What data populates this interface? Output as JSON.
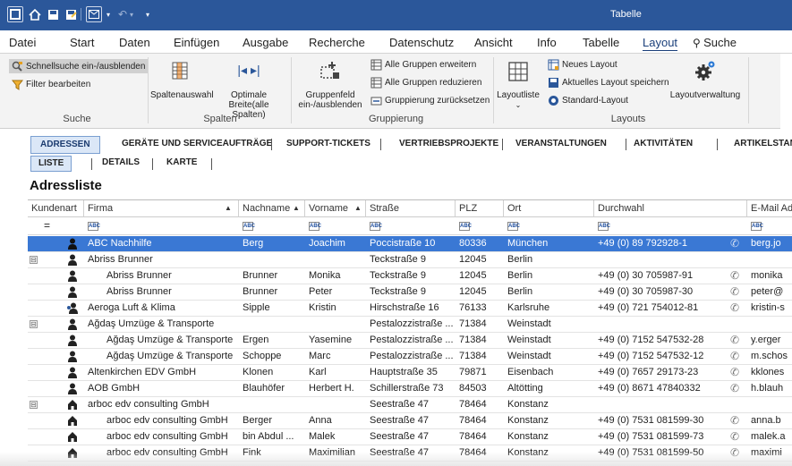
{
  "window": {
    "title": "Tabelle",
    "accent": "#2b579a"
  },
  "quick_access": [
    {
      "icon": "app-icon"
    },
    {
      "icon": "home-icon"
    },
    {
      "icon": "save-icon"
    },
    {
      "icon": "save-as-icon"
    },
    {
      "icon": "mail-icon"
    },
    {
      "icon": "undo-icon"
    },
    {
      "icon": "redo-icon"
    },
    {
      "icon": "customize-icon"
    }
  ],
  "menu": {
    "items": [
      "Datei",
      "Start",
      "Daten",
      "Einfügen",
      "Ausgabe",
      "Recherche",
      "Datenschutz",
      "Ansicht",
      "Info",
      "Tabelle",
      "Layout",
      "Suche"
    ],
    "active": "Layout"
  },
  "ribbon": {
    "suche": {
      "label": "Suche",
      "quicksearch": "Schnellsuche ein-/ausblenden",
      "filter": "Filter bearbeiten"
    },
    "spalten": {
      "label": "Spalten",
      "auswahl": "Spaltenauswahl",
      "breite": "Optimale Breite(alle Spalten)"
    },
    "gruppierung": {
      "label": "Gruppierung",
      "gruppenfeld": "Gruppenfeld ein-/ausblenden",
      "erweitern": "Alle Gruppen erweitern",
      "reduzieren": "Alle Gruppen reduzieren",
      "zuruecksetzen": "Gruppierung zurücksetzen"
    },
    "layouts": {
      "label": "Layouts",
      "layoutliste": "Layoutliste",
      "neues": "Neues Layout",
      "speichern": "Aktuelles Layout speichern",
      "standard": "Standard-Layout",
      "verwaltung": "Layoutverwaltung"
    }
  },
  "tabs": [
    "ADRESSEN",
    "GERÄTE UND SERVICEAUFTRÄGE",
    "SUPPORT-TICKETS",
    "VERTRIEBSPROJEKTE",
    "VERANSTALTUNGEN",
    "AKTIVITÄTEN",
    "ARTIKELSTAMM"
  ],
  "subtabs": [
    "LISTE",
    "DETAILS",
    "KARTE"
  ],
  "section_title": "Adressliste",
  "columns": [
    "Kundenart",
    "Firma",
    "Nachname",
    "Vorname",
    "Straße",
    "PLZ",
    "Ort",
    "Durchwahl",
    "E-Mail Ad"
  ],
  "filter_row": {
    "kundenart": "=",
    "abc": "ABC"
  },
  "rows": [
    {
      "type": "person",
      "expand": "",
      "indent": 0,
      "firma": "ABC Nachhilfe",
      "nachname": "Berg",
      "vorname": "Joachim",
      "strasse": "Poccistraße 10",
      "plz": "80336",
      "ort": "München",
      "durchwahl": "+49 (0) 89 792928-1",
      "phone": true,
      "email": "berg.jo",
      "selected": true
    },
    {
      "type": "person",
      "expand": "⊟",
      "indent": 0,
      "firma": "Abriss Brunner",
      "nachname": "",
      "vorname": "",
      "strasse": "Teckstraße 9",
      "plz": "12045",
      "ort": "Berlin",
      "durchwahl": "",
      "phone": false,
      "email": ""
    },
    {
      "type": "person",
      "expand": "",
      "indent": 1,
      "firma": "Abriss Brunner",
      "nachname": "Brunner",
      "vorname": "Monika",
      "strasse": "Teckstraße 9",
      "plz": "12045",
      "ort": "Berlin",
      "durchwahl": "+49 (0) 30 705987-91",
      "phone": true,
      "email": "monika"
    },
    {
      "type": "person",
      "expand": "",
      "indent": 1,
      "firma": "Abriss Brunner",
      "nachname": "Brunner",
      "vorname": "Peter",
      "strasse": "Teckstraße 9",
      "plz": "12045",
      "ort": "Berlin",
      "durchwahl": "+49 (0) 30 705987-30",
      "phone": true,
      "email": "peter@"
    },
    {
      "type": "person2",
      "expand": "",
      "indent": 0,
      "firma": "Aeroga Luft & Klima",
      "nachname": "Sipple",
      "vorname": "Kristin",
      "strasse": "Hirschstraße 16",
      "plz": "76133",
      "ort": "Karlsruhe",
      "durchwahl": "+49 (0) 721 754012-81",
      "phone": true,
      "email": "kristin-s"
    },
    {
      "type": "person",
      "expand": "⊟",
      "indent": 0,
      "firma": "Ağdaş Umzüge & Transporte",
      "nachname": "",
      "vorname": "",
      "strasse": "Pestalozzistraße ...",
      "plz": "71384",
      "ort": "Weinstadt",
      "durchwahl": "",
      "phone": false,
      "email": ""
    },
    {
      "type": "person",
      "expand": "",
      "indent": 1,
      "firma": "Ağdaş Umzüge & Transporte",
      "nachname": "Ergen",
      "vorname": "Yasemine",
      "strasse": "Pestalozzistraße ...",
      "plz": "71384",
      "ort": "Weinstadt",
      "durchwahl": "+49 (0) 7152 547532-28",
      "phone": true,
      "email": "y.erger"
    },
    {
      "type": "person",
      "expand": "",
      "indent": 1,
      "firma": "Ağdaş Umzüge & Transporte",
      "nachname": "Schoppe",
      "vorname": "Marc",
      "strasse": "Pestalozzistraße ...",
      "plz": "71384",
      "ort": "Weinstadt",
      "durchwahl": "+49 (0) 7152 547532-12",
      "phone": true,
      "email": "m.schos"
    },
    {
      "type": "person",
      "expand": "",
      "indent": 0,
      "firma": "Altenkirchen EDV GmbH",
      "nachname": "Klonen",
      "vorname": "Karl",
      "strasse": "Hauptstraße 35",
      "plz": "79871",
      "ort": "Eisenbach",
      "durchwahl": "+49 (0) 7657 29173-23",
      "phone": true,
      "email": "kklones"
    },
    {
      "type": "person",
      "expand": "",
      "indent": 0,
      "firma": "AOB GmbH",
      "nachname": "Blauhöfer",
      "vorname": "Herbert H.",
      "strasse": "Schillerstraße 73",
      "plz": "84503",
      "ort": "Altötting",
      "durchwahl": "+49 (0) 8671 47840332",
      "phone": true,
      "email": "h.blauh"
    },
    {
      "type": "house",
      "expand": "⊟",
      "indent": 0,
      "firma": "arboc edv consulting GmbH",
      "nachname": "",
      "vorname": "",
      "strasse": "Seestraße 47",
      "plz": "78464",
      "ort": "Konstanz",
      "durchwahl": "",
      "phone": false,
      "email": ""
    },
    {
      "type": "house",
      "expand": "",
      "indent": 1,
      "firma": "arboc edv consulting GmbH",
      "nachname": "Berger",
      "vorname": "Anna",
      "strasse": "Seestraße 47",
      "plz": "78464",
      "ort": "Konstanz",
      "durchwahl": "+49 (0) 7531 081599-30",
      "phone": true,
      "email": "anna.b"
    },
    {
      "type": "house",
      "expand": "",
      "indent": 1,
      "firma": "arboc edv consulting GmbH",
      "nachname": "bin Abdul ...",
      "vorname": "Malek",
      "strasse": "Seestraße 47",
      "plz": "78464",
      "ort": "Konstanz",
      "durchwahl": "+49 (0) 7531 081599-73",
      "phone": true,
      "email": "malek.a"
    },
    {
      "type": "house",
      "expand": "",
      "indent": 1,
      "firma": "arboc edv consulting GmbH",
      "nachname": "Fink",
      "vorname": "Maximilian",
      "strasse": "Seestraße 47",
      "plz": "78464",
      "ort": "Konstanz",
      "durchwahl": "+49 (0) 7531 081599-50",
      "phone": true,
      "email": "maximi"
    }
  ]
}
